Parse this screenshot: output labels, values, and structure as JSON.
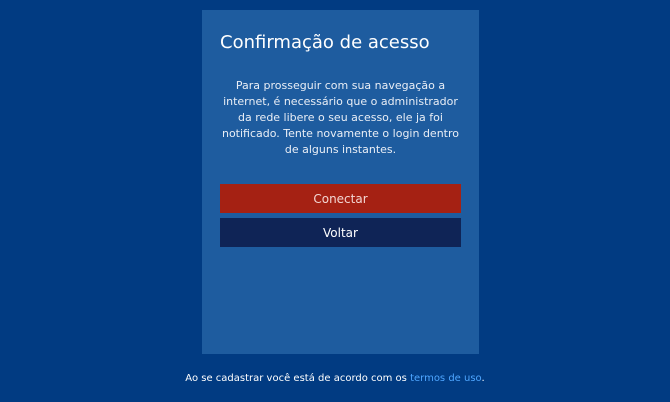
{
  "card": {
    "title": "Confirmação de acesso",
    "message": "Para prosseguir com sua navegação a internet, é necessário que o administrador da rede libere o seu acesso, ele ja foi notificado. Tente novamente o login dentro de alguns instantes.",
    "connect_label": "Conectar",
    "back_label": "Voltar"
  },
  "footer": {
    "text": "Ao se cadastrar você está de acordo com os ",
    "link_label": "termos de uso",
    "suffix": "."
  },
  "colors": {
    "background": "#013b82",
    "card": "#1e5c9f",
    "connect_button": "#a52113",
    "back_button": "#0f2456",
    "link": "#4ea6ff"
  }
}
